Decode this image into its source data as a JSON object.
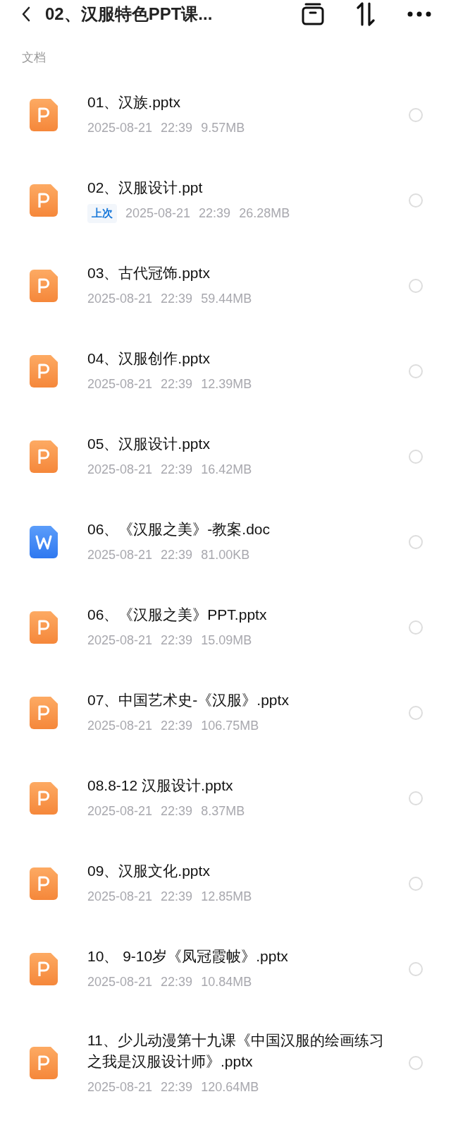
{
  "header": {
    "title": "02、汉服特色PPT课..."
  },
  "section": {
    "label": "文档"
  },
  "files": [
    {
      "kind": "ppt",
      "name": "01、汉族.pptx",
      "date": "2025-08-21",
      "time": "22:39",
      "size": "9.57MB",
      "selected": false
    },
    {
      "kind": "ppt",
      "name": "02、汉服设计.ppt",
      "tag": "上次",
      "date": "2025-08-21",
      "time": "22:39",
      "size": "26.28MB",
      "selected": false
    },
    {
      "kind": "ppt",
      "name": "03、古代冠饰.pptx",
      "date": "2025-08-21",
      "time": "22:39",
      "size": "59.44MB",
      "selected": false
    },
    {
      "kind": "ppt",
      "name": "04、汉服创作.pptx",
      "date": "2025-08-21",
      "time": "22:39",
      "size": "12.39MB",
      "selected": false
    },
    {
      "kind": "ppt",
      "name": "05、汉服设计.pptx",
      "date": "2025-08-21",
      "time": "22:39",
      "size": "16.42MB",
      "selected": false
    },
    {
      "kind": "doc",
      "name": "06、《汉服之美》-教案.doc",
      "date": "2025-08-21",
      "time": "22:39",
      "size": "81.00KB",
      "selected": false
    },
    {
      "kind": "ppt",
      "name": "06、《汉服之美》PPT.pptx",
      "date": "2025-08-21",
      "time": "22:39",
      "size": "15.09MB",
      "selected": false
    },
    {
      "kind": "ppt",
      "name": "07、中国艺术史-《汉服》.pptx",
      "date": "2025-08-21",
      "time": "22:39",
      "size": "106.75MB",
      "selected": false
    },
    {
      "kind": "ppt",
      "name": "08.8-12 汉服设计.pptx",
      "date": "2025-08-21",
      "time": "22:39",
      "size": "8.37MB",
      "selected": false
    },
    {
      "kind": "ppt",
      "name": "09、汉服文化.pptx",
      "date": "2025-08-21",
      "time": "22:39",
      "size": "12.85MB",
      "selected": false
    },
    {
      "kind": "ppt",
      "name": "10、 9-10岁《凤冠霞帔》.pptx",
      "date": "2025-08-21",
      "time": "22:39",
      "size": "10.84MB",
      "selected": false
    },
    {
      "kind": "ppt",
      "name": "11、少儿动漫第十九课《中国汉服的绘画练习之我是汉服设计师》.pptx",
      "date": "2025-08-21",
      "time": "22:39",
      "size": "120.64MB",
      "selected": false
    }
  ]
}
